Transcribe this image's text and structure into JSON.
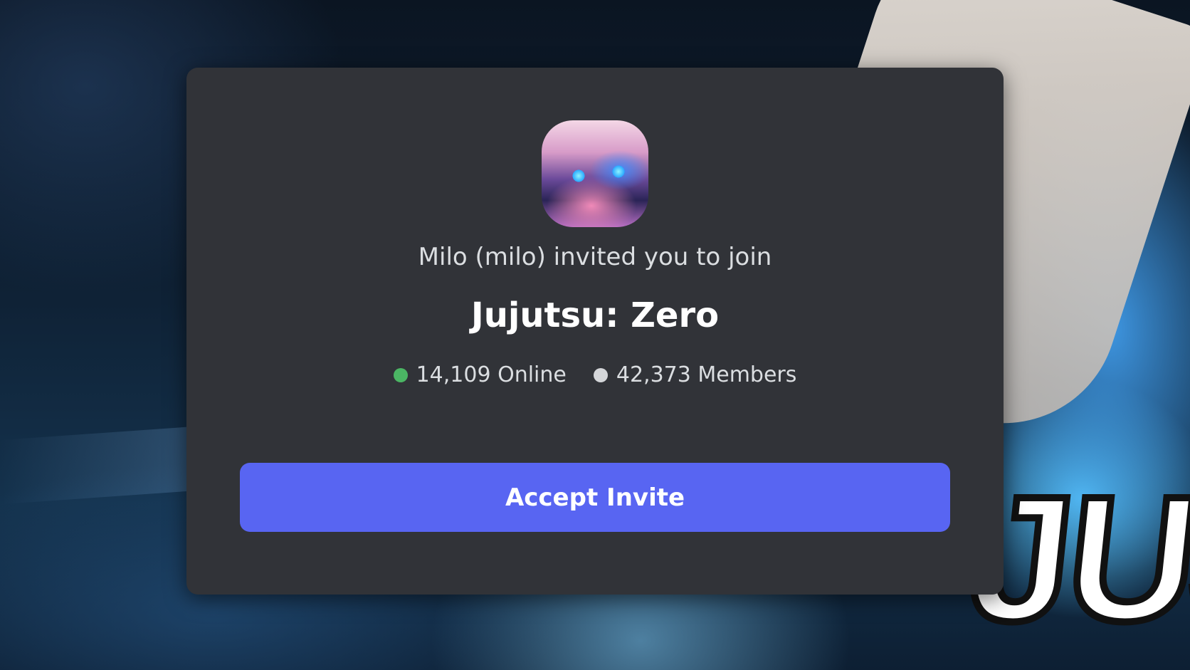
{
  "invite": {
    "message": "Milo (milo) invited you to join",
    "server_name": "Jujutsu: Zero",
    "online_count": "14,109 Online",
    "member_count": "42,373 Members",
    "accept_label": "Accept Invite"
  },
  "background": {
    "logo_text": "JUJ"
  },
  "colors": {
    "modal_bg": "#313338",
    "accent": "#5865f2",
    "online_dot": "#4bb664",
    "members_dot": "#d4d6d9"
  },
  "icons": {
    "server": "server-avatar-anime-character",
    "online": "online-status-dot",
    "members": "members-status-dot"
  }
}
